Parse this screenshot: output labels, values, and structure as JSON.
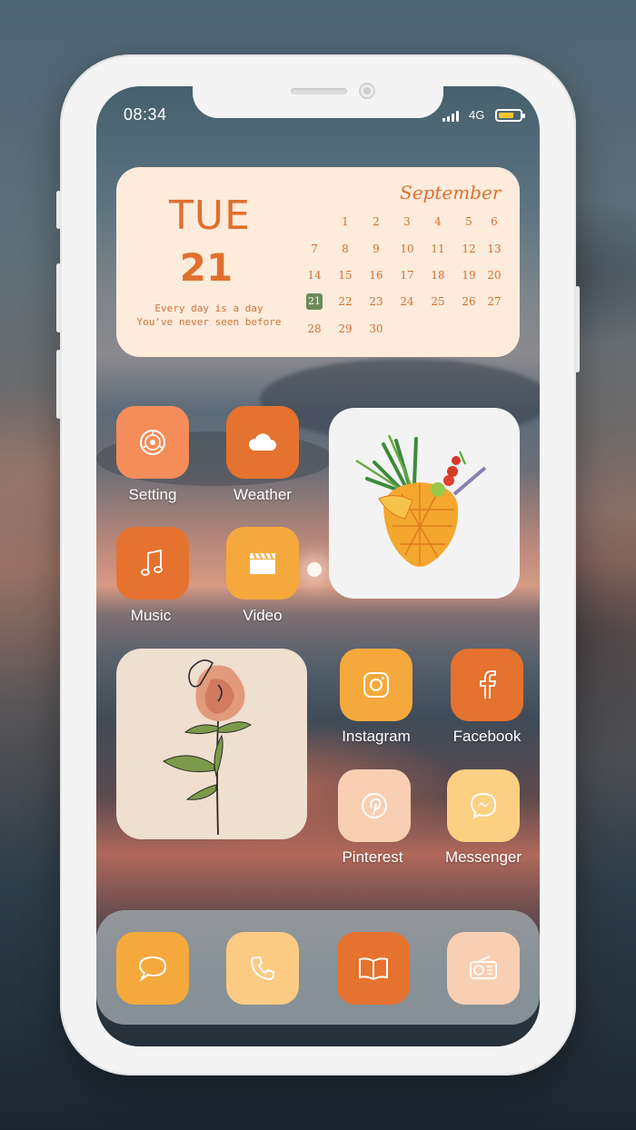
{
  "status_bar": {
    "time": "08:34",
    "network": "4G"
  },
  "calendar_widget": {
    "weekday": "TUE",
    "day": "21",
    "quote_line1": "Every day is a day",
    "quote_line2": "You've never seen before",
    "month": "September",
    "weeks": [
      [
        "",
        "",
        "1",
        "2",
        "3",
        "4",
        "5",
        "6"
      ],
      [
        "7",
        "8",
        "9",
        "10",
        "11",
        "12",
        "13"
      ],
      [
        "14",
        "15",
        "16",
        "17",
        "18",
        "19",
        "20"
      ],
      [
        "21",
        "22",
        "23",
        "24",
        "25",
        "26",
        "27"
      ],
      [
        "28",
        "29",
        "30"
      ]
    ],
    "today": "21"
  },
  "apps": {
    "setting": {
      "label": "Setting",
      "icon": "gear-icon",
      "color": "#f48d5a"
    },
    "weather": {
      "label": "Weather",
      "icon": "cloud-icon",
      "color": "#e5722f"
    },
    "music": {
      "label": "Music",
      "icon": "music-note-icon",
      "color": "#e5722f"
    },
    "video": {
      "label": "Video",
      "icon": "clapperboard-icon",
      "color": "#f5a93d"
    },
    "instagram": {
      "label": "Instagram",
      "icon": "instagram-icon",
      "color": "#f5a93d"
    },
    "facebook": {
      "label": "Facebook",
      "icon": "facebook-icon",
      "color": "#e5722f"
    },
    "pinterest": {
      "label": "Pinterest",
      "icon": "pinterest-icon",
      "color": "#f9cfb3"
    },
    "messenger": {
      "label": "Messenger",
      "icon": "messenger-icon",
      "color": "#fbd083"
    }
  },
  "widgets": {
    "drink": {
      "icon": "pineapple-drink-illustration",
      "bg": "#f3f3f3"
    },
    "rose": {
      "icon": "rose-line-art",
      "bg": "#efdfcf"
    }
  },
  "dock": [
    {
      "icon": "chat-bubble-icon",
      "color": "#f5a93d"
    },
    {
      "icon": "phone-icon",
      "color": "#fbcb83"
    },
    {
      "icon": "book-icon",
      "color": "#e5722f"
    },
    {
      "icon": "radio-icon",
      "color": "#f9cfb3"
    }
  ]
}
